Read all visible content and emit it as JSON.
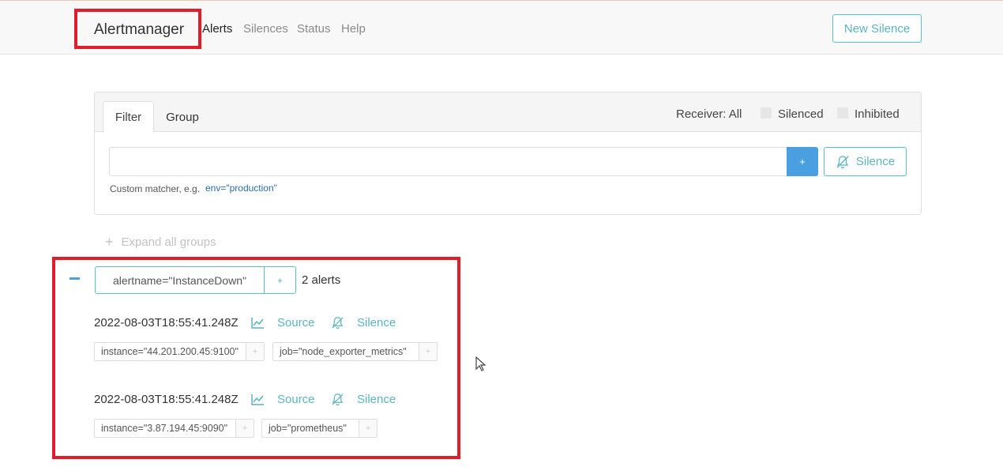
{
  "header": {
    "brand": "Alertmanager",
    "nav": [
      "Alerts",
      "Silences",
      "Status",
      "Help"
    ],
    "new_silence": "New Silence"
  },
  "filter_card": {
    "tabs": [
      "Filter",
      "Group"
    ],
    "receiver": "Receiver: All",
    "silenced": "Silenced",
    "inhibited": "Inhibited",
    "input_value": "",
    "add_button": "+",
    "silence_button": "Silence",
    "hint_prefix": "Custom matcher, e.g.",
    "hint_example": "env=\"production\""
  },
  "expand_all": "Expand all groups",
  "group": {
    "label": "alertname=\"InstanceDown\"",
    "plus": "+",
    "count": "2 alerts",
    "alerts": [
      {
        "timestamp": "2022-08-03T18:55:41.248Z",
        "source": "Source",
        "silence": "Silence",
        "labels": [
          "instance=\"44.201.200.45:9100\"",
          "job=\"node_exporter_metrics\""
        ]
      },
      {
        "timestamp": "2022-08-03T18:55:41.248Z",
        "source": "Source",
        "silence": "Silence",
        "labels": [
          "instance=\"3.87.194.45:9090\"",
          "job=\"prometheus\""
        ]
      }
    ]
  },
  "label_plus": "+",
  "colors": {
    "accent": "#5bc0c8",
    "primary": "#4a9fe0",
    "highlight": "#e01e2b"
  },
  "icons": [
    "chart-line-icon",
    "bell-slash-icon",
    "plus-icon",
    "minus-icon",
    "mouse-cursor-icon"
  ]
}
